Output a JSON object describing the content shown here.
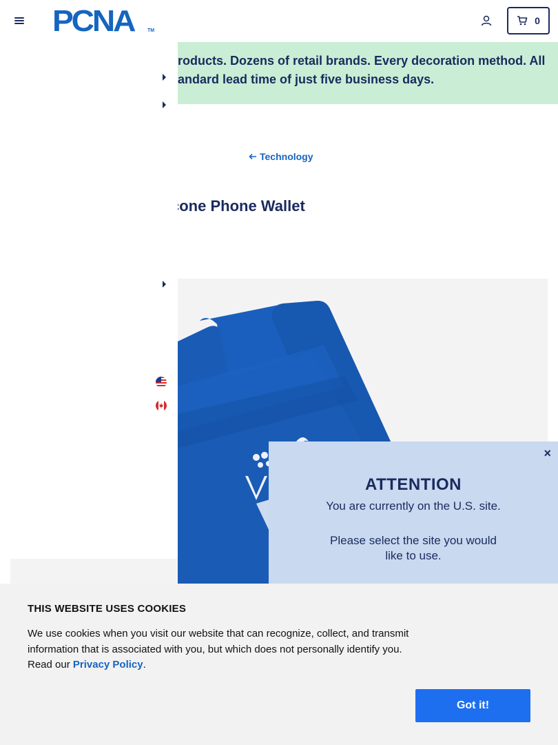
{
  "header": {
    "logo_text": "PCNA",
    "logo_tm": "TM",
    "cart_count": "0"
  },
  "banner": {
    "text_line1": "roducts. Dozens of retail brands. Every decoration method. All",
    "text_line2": "andard lead time of just five business days."
  },
  "breadcrumb": {
    "back_label": "Technology"
  },
  "product": {
    "title": "cone Phone Wallet"
  },
  "attention_modal": {
    "title": "ATTENTION",
    "line1": "You are currently on the U.S. site.",
    "line2": "Please select the site you would like to use.",
    "close_label": "×"
  },
  "cookies": {
    "title": "THIS WEBSITE USES COOKIES",
    "text_before_link": "We use cookies when you visit our website that can recognize, collect, and transmit information that is associated with you, but which does not personally identify you. Read our ",
    "link_text": "Privacy Policy",
    "text_after_link": ".",
    "button_label": "Got it!"
  },
  "colors": {
    "brand_blue": "#1565c0",
    "navy": "#1a2a5e",
    "banner_green": "#c9eed5",
    "modal_blue": "#c8d9f0",
    "product_blue": "#1a5bb5",
    "button_blue": "#1e6ff0"
  },
  "icons": {
    "menu": "hamburger-menu-icon",
    "account": "user-icon",
    "cart": "cart-icon",
    "back": "arrow-left-icon",
    "chevron": "chevron-right-icon",
    "us_flag": "us-flag-icon",
    "ca_flag": "canada-flag-icon",
    "close": "close-icon"
  }
}
